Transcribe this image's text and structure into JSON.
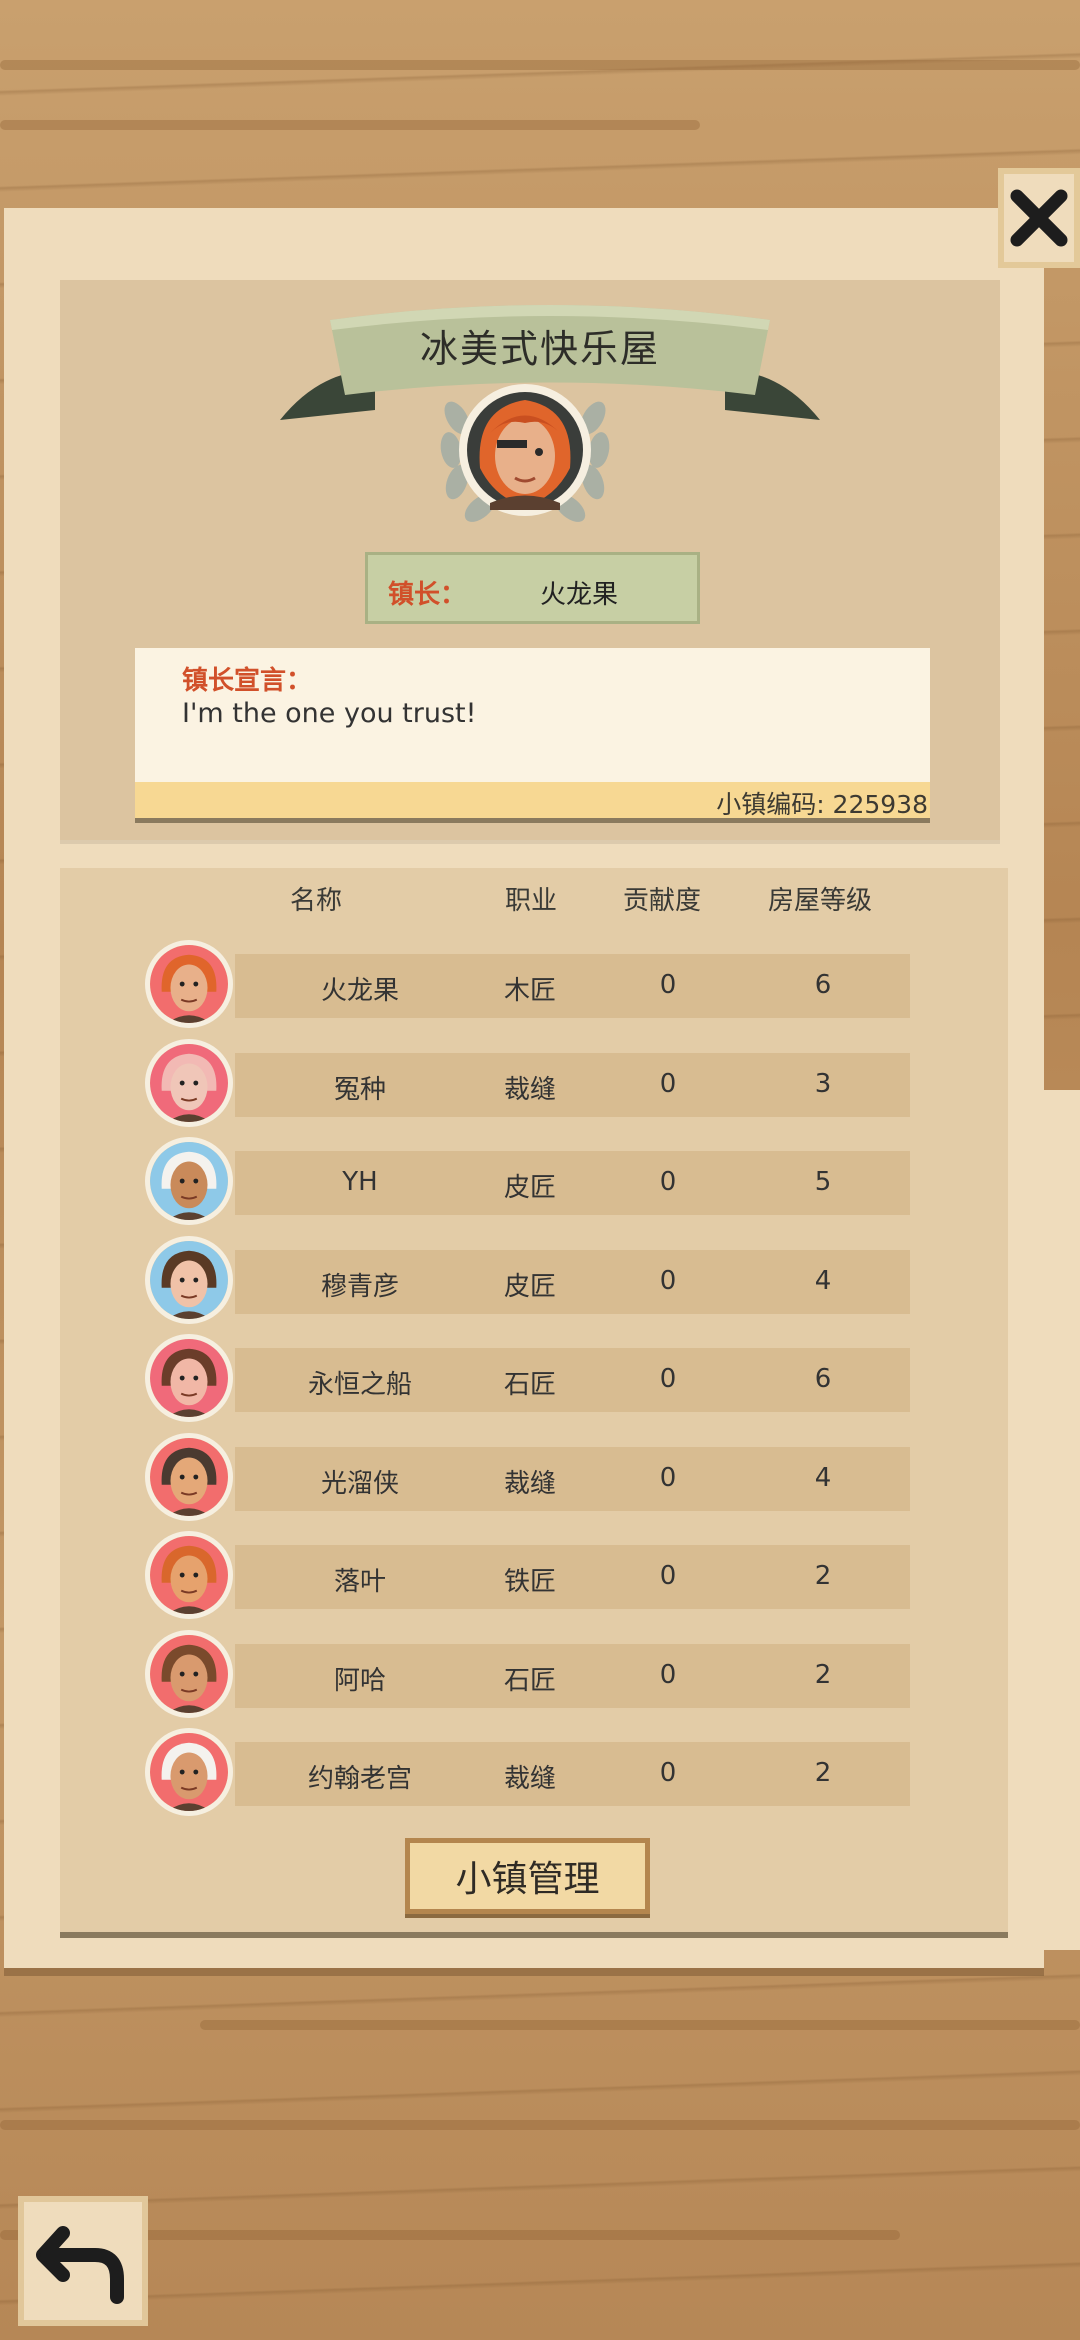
{
  "town": {
    "name": "冰美式快乐屋",
    "mayor_label": "镇长：",
    "mayor_name": "火龙果",
    "declaration_title": "镇长宣言：",
    "declaration_text": "I'm the one you trust!",
    "town_code_text": "小镇编码: 225938"
  },
  "table": {
    "headers": [
      "名称",
      "职业",
      "贡献度",
      "房屋等级"
    ],
    "rows": [
      {
        "name": "火龙果",
        "job": "木匠",
        "contribution": "0",
        "house_level": "6",
        "hair": "#e0652b",
        "skin": "#e8b08a",
        "bg": "#f26d6d"
      },
      {
        "name": "冤种",
        "job": "裁缝",
        "contribution": "0",
        "house_level": "3",
        "hair": "#f2b9b4",
        "skin": "#f0c6b8",
        "bg": "#f06a7a"
      },
      {
        "name": "YH",
        "job": "皮匠",
        "contribution": "0",
        "house_level": "5",
        "hair": "#f4f2ee",
        "skin": "#c98a5a",
        "bg": "#8ec9e8"
      },
      {
        "name": "穆青彦",
        "job": "皮匠",
        "contribution": "0",
        "house_level": "4",
        "hair": "#5a3a25",
        "skin": "#f0c2a8",
        "bg": "#8ec9e8"
      },
      {
        "name": "永恒之船",
        "job": "石匠",
        "contribution": "0",
        "house_level": "6",
        "hair": "#6b3d2a",
        "skin": "#f1b7a6",
        "bg": "#f06a7a"
      },
      {
        "name": "光溜侠",
        "job": "裁缝",
        "contribution": "0",
        "house_level": "4",
        "hair": "#4a3a30",
        "skin": "#e4a878",
        "bg": "#f26d6d"
      },
      {
        "name": "落叶",
        "job": "铁匠",
        "contribution": "0",
        "house_level": "2",
        "hair": "#d9672c",
        "skin": "#e6a26d",
        "bg": "#f26d6d"
      },
      {
        "name": "阿哈",
        "job": "石匠",
        "contribution": "0",
        "house_level": "2",
        "hair": "#7a4a2c",
        "skin": "#d99a6e",
        "bg": "#f26d6d"
      },
      {
        "name": "约翰老宫",
        "job": "裁缝",
        "contribution": "0",
        "house_level": "2",
        "hair": "#f4f2ee",
        "skin": "#d99a6e",
        "bg": "#f26d6d"
      }
    ]
  },
  "buttons": {
    "manage_label": "小镇管理",
    "close_icon": "close-x-icon",
    "back_icon": "back-arrow-icon"
  },
  "colors": {
    "accent_red": "#d1502a",
    "paper": "#efdcbc"
  }
}
